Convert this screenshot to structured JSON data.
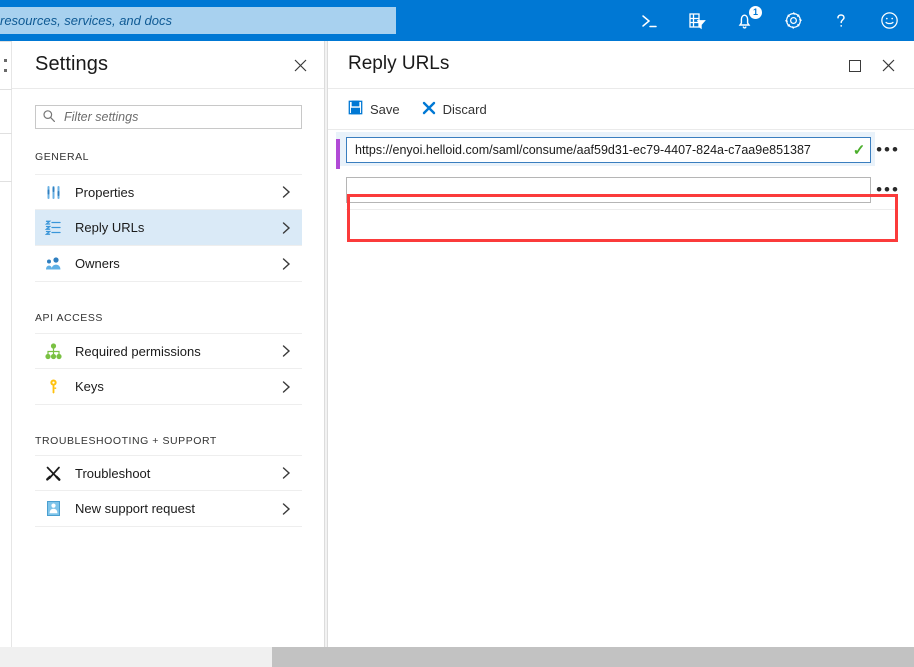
{
  "topbar": {
    "search_placeholder": "resources, services, and docs",
    "search_value": "",
    "icons": [
      {
        "name": "cloud-shell-icon",
        "glyph": ">_"
      },
      {
        "name": "directory-filter-icon",
        "glyph": "filter"
      },
      {
        "name": "notifications-bell-icon",
        "glyph": "bell",
        "badge": "1"
      },
      {
        "name": "settings-gear-icon",
        "glyph": "gear"
      },
      {
        "name": "help-question-icon",
        "glyph": "?"
      },
      {
        "name": "feedback-smiley-icon",
        "glyph": "smiley"
      }
    ]
  },
  "settings": {
    "title": "Settings",
    "close_label": "✕",
    "filter_placeholder": "Filter settings",
    "filter_value": "",
    "groups": [
      {
        "header": "GENERAL",
        "items": [
          {
            "label": "Properties",
            "icon": "sliders-icon",
            "selected": false
          },
          {
            "label": "Reply URLs",
            "icon": "list-checks-icon",
            "selected": true
          },
          {
            "label": "Owners",
            "icon": "people-icon",
            "selected": false
          }
        ]
      },
      {
        "header": "API ACCESS",
        "items": [
          {
            "label": "Required permissions",
            "icon": "hierarchy-icon",
            "selected": false
          },
          {
            "label": "Keys",
            "icon": "key-icon",
            "selected": false
          }
        ]
      },
      {
        "header": "TROUBLESHOOTING + SUPPORT",
        "items": [
          {
            "label": "Troubleshoot",
            "icon": "tools-icon",
            "selected": false
          },
          {
            "label": "New support request",
            "icon": "support-person-icon",
            "selected": false
          }
        ]
      }
    ]
  },
  "reply_urls": {
    "title": "Reply URLs",
    "maximize_label": "□",
    "close_label": "✕",
    "toolbar": {
      "save_label": "Save",
      "discard_label": "Discard"
    },
    "rows": [
      {
        "value": "https://enyoi.helloid.com/saml/consume/aaf59d31-ec79-4407-824a-c7aa9e851387",
        "valid": true,
        "valid_glyph": "✓",
        "ellipsis": "•••",
        "highlighted": true
      },
      {
        "value": "",
        "valid": false,
        "valid_glyph": "",
        "ellipsis": "•••",
        "highlighted": false
      }
    ]
  },
  "colors": {
    "brand_blue": "#0078d4",
    "selected_row": "#daeaf7",
    "accent_purple": "#b14ad6",
    "annotation_red": "#fb3b3b",
    "valid_green": "#4caf2d"
  }
}
